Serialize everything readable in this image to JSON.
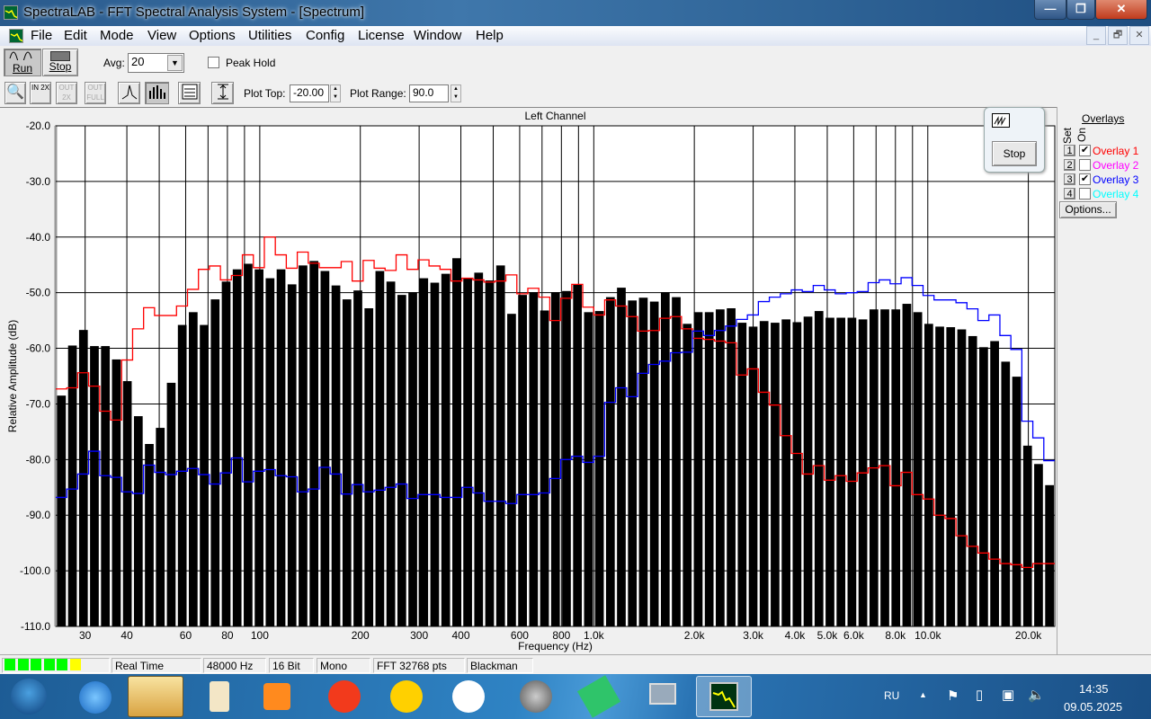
{
  "window": {
    "title": "SpectraLAB - FFT Spectral Analysis System - [Spectrum]",
    "min": "—",
    "restore": "❐",
    "close": "✕"
  },
  "menu": [
    "File",
    "Edit",
    "Mode",
    "View",
    "Options",
    "Utilities",
    "Config",
    "License",
    "Window",
    "Help"
  ],
  "mdi": {
    "min": "_",
    "restore": "🗗",
    "close": "✕"
  },
  "toolbar": {
    "run": "Run",
    "stop": "Stop",
    "avg_label": "Avg:",
    "avg_value": "20",
    "peak_hold": "Peak Hold",
    "peak_hold_checked": false,
    "zoom_in": "IN 2X",
    "zoom_out": "OUT 2X",
    "zoom_full": "OUT FULL",
    "plot_top_label": "Plot Top:",
    "plot_top": "-20.00",
    "plot_range_label": "Plot Range:",
    "plot_range": "90.0"
  },
  "float_window": {
    "stop": "Stop"
  },
  "overlays": {
    "title": "Overlays",
    "set_header": "Set",
    "on_header": "On",
    "options": "Options...",
    "items": [
      {
        "set": "1",
        "label": "Overlay 1",
        "on": true,
        "color": "#ff0000"
      },
      {
        "set": "2",
        "label": "Overlay 2",
        "on": false,
        "color": "#ff00ff"
      },
      {
        "set": "3",
        "label": "Overlay 3",
        "on": true,
        "color": "#0000ff"
      },
      {
        "set": "4",
        "label": "Overlay 4",
        "on": false,
        "color": "#00ffff"
      }
    ]
  },
  "status": {
    "level_leds": [
      "#00ff00",
      "#00ff00",
      "#00ff00",
      "#00ff00",
      "#00ff00",
      "#ffff00"
    ],
    "mode": "Real Time",
    "rate": "48000 Hz",
    "bits": "16 Bit",
    "channels": "Mono",
    "fft": "FFT 32768 pts",
    "window": "Blackman"
  },
  "taskbar": {
    "lang": "RU",
    "time": "14:35",
    "date": "09.05.2025"
  },
  "chart_data": {
    "type": "bar",
    "title": "Left Channel",
    "xlabel": "Frequency (Hz)",
    "ylabel": "Relative Amplitude (dB)",
    "xscale": "log",
    "xlim": [
      24.5,
      24000
    ],
    "ylim": [
      -110,
      -20
    ],
    "grid": true,
    "yticks": [
      "-20.0",
      "-30.0",
      "-40.0",
      "-50.0",
      "-60.0",
      "-70.0",
      "-80.0",
      "-90.0",
      "-100.0",
      "-110.0"
    ],
    "ytick_values": [
      -20,
      -30,
      -40,
      -50,
      -60,
      -70,
      -80,
      -90,
      -100,
      -110
    ],
    "xgrid_values": [
      30,
      40,
      50,
      60,
      70,
      80,
      90,
      100,
      200,
      300,
      400,
      500,
      600,
      700,
      800,
      900,
      1000,
      2000,
      3000,
      4000,
      5000,
      6000,
      7000,
      8000,
      9000,
      10000,
      20000
    ],
    "xticks": [
      {
        "v": 30,
        "l": "30"
      },
      {
        "v": 40,
        "l": "40"
      },
      {
        "v": 60,
        "l": "60"
      },
      {
        "v": 80,
        "l": "80"
      },
      {
        "v": 100,
        "l": "100"
      },
      {
        "v": 200,
        "l": "200"
      },
      {
        "v": 300,
        "l": "300"
      },
      {
        "v": 400,
        "l": "400"
      },
      {
        "v": 600,
        "l": "600"
      },
      {
        "v": 800,
        "l": "800"
      },
      {
        "v": 1000,
        "l": "1.0k"
      },
      {
        "v": 2000,
        "l": "2.0k"
      },
      {
        "v": 3000,
        "l": "3.0k"
      },
      {
        "v": 4000,
        "l": "4.0k"
      },
      {
        "v": 5000,
        "l": "5.0k"
      },
      {
        "v": 6000,
        "l": "6.0k"
      },
      {
        "v": 8000,
        "l": "8.0k"
      },
      {
        "v": 10000,
        "l": "10.0k"
      },
      {
        "v": 20000,
        "l": "20.0k"
      }
    ],
    "bars": [
      -68.5,
      -59.5,
      -56.7,
      -59.6,
      -59.6,
      -62,
      -65.9,
      -72.2,
      -77.2,
      -74.3,
      -66.2,
      -55.8,
      -53.5,
      -55.8,
      -51.2,
      -48,
      -45.8,
      -44.8,
      -45.8,
      -47.4,
      -45.8,
      -48.5,
      -45.1,
      -44.3,
      -46.1,
      -48.7,
      -51.2,
      -49.6,
      -52.8,
      -46.1,
      -48,
      -50.4,
      -49.9,
      -47.4,
      -48.2,
      -46.6,
      -43.8,
      -47.4,
      -46.4,
      -47.8,
      -45.1,
      -53.8,
      -50.4,
      -49.9,
      -53.2,
      -49.9,
      -49.7,
      -48.5,
      -53.5,
      -53.3,
      -50.8,
      -49.1,
      -51.4,
      -50.9,
      -51.6,
      -49.9,
      -50.8,
      -55.6,
      -53.5,
      -53.5,
      -53,
      -52.8,
      -55.4,
      -56.1,
      -55.1,
      -55.4,
      -54.8,
      -55.3,
      -54.3,
      -53.3,
      -54.5,
      -54.5,
      -54.5,
      -54.8,
      -53,
      -53,
      -53,
      -52,
      -53.5,
      -55.6,
      -56.1,
      -56.2,
      -56.6,
      -57.8,
      -59.8,
      -58.7,
      -62.4,
      -65.1,
      -77.5,
      -80.8,
      -84.6
    ],
    "series": [
      {
        "name": "Overlay 1",
        "color": "#ff0000",
        "values": [
          -67.3,
          -67.1,
          -64.4,
          -66.8,
          -71.3,
          -72.9,
          -62.1,
          -56.5,
          -52.7,
          -54.1,
          -54.1,
          -52.4,
          -49.4,
          -45.8,
          -45.2,
          -47.7,
          -46.9,
          -43.2,
          -45.5,
          -40,
          -43.2,
          -45.6,
          -42.7,
          -44.7,
          -45.5,
          -45.5,
          -44.4,
          -47.9,
          -44.2,
          -45.6,
          -46,
          -43.2,
          -45.8,
          -44.1,
          -45.2,
          -45.8,
          -47.9,
          -47.4,
          -47.7,
          -48.1,
          -47.9,
          -46.8,
          -50.2,
          -49.2,
          -50.8,
          -55,
          -51,
          -48.5,
          -52.6,
          -54,
          -51.3,
          -52.4,
          -54.3,
          -56.9,
          -56.8,
          -54.6,
          -54.3,
          -56.5,
          -58.2,
          -58.4,
          -58.7,
          -59,
          -64.8,
          -63.7,
          -67.9,
          -70.2,
          -75.7,
          -78.9,
          -82.6,
          -81.1,
          -83.7,
          -82.9,
          -83.9,
          -82.4,
          -81.5,
          -81.1,
          -84.7,
          -82.3,
          -86.3,
          -87.1,
          -90,
          -90.6,
          -93.7,
          -95.6,
          -96.8,
          -97.9,
          -98.7,
          -98.9,
          -99.4,
          -98.7,
          -98.7
        ]
      },
      {
        "name": "Overlay 3",
        "color": "#0000ff",
        "values": [
          -86.8,
          -85.3,
          -82.6,
          -78.5,
          -82.9,
          -83.2,
          -85.8,
          -86.1,
          -81,
          -82.3,
          -82.7,
          -82.1,
          -81.6,
          -82.7,
          -84.4,
          -82.4,
          -79.7,
          -84,
          -82.1,
          -81.8,
          -82.9,
          -83.1,
          -85.8,
          -85.3,
          -81.4,
          -82.6,
          -86.2,
          -84.5,
          -85.8,
          -85.5,
          -85,
          -84.4,
          -87,
          -86.3,
          -86.3,
          -86.8,
          -86.8,
          -85,
          -86,
          -87.5,
          -87.5,
          -87.9,
          -86.3,
          -86.3,
          -86,
          -83.4,
          -80,
          -79.4,
          -80.5,
          -79.4,
          -69.7,
          -67.1,
          -68.7,
          -64.5,
          -62.9,
          -62.3,
          -60.8,
          -60.7,
          -56.9,
          -57.7,
          -56.8,
          -56,
          -54.8,
          -54,
          -51.6,
          -50.8,
          -50.2,
          -49.5,
          -49.8,
          -48.7,
          -49.5,
          -50.2,
          -50,
          -49.8,
          -48.2,
          -47.7,
          -48.4,
          -47.3,
          -48.7,
          -50.5,
          -51.3,
          -51.3,
          -51.8,
          -52.9,
          -55,
          -54,
          -57.7,
          -60.2,
          -73.1,
          -76.1,
          -80.2
        ]
      }
    ]
  }
}
